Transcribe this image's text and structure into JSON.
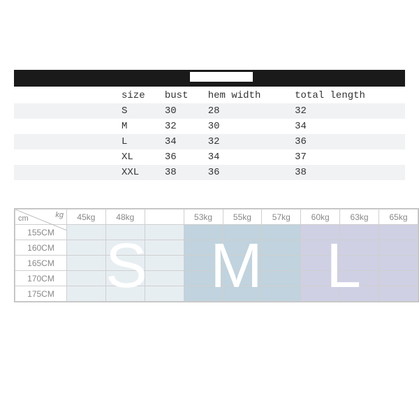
{
  "size_table": {
    "headers": [
      "size",
      "bust",
      "hem width",
      "total length"
    ],
    "rows": [
      {
        "size": "S",
        "bust": "30",
        "hem": "28",
        "total": "32"
      },
      {
        "size": "M",
        "bust": "32",
        "hem": "30",
        "total": "34"
      },
      {
        "size": "L",
        "bust": "34",
        "hem": "32",
        "total": "36"
      },
      {
        "size": "XL",
        "bust": "36",
        "hem": "34",
        "total": "37"
      },
      {
        "size": "XXL",
        "bust": "38",
        "hem": "36",
        "total": "38"
      }
    ]
  },
  "hw_table": {
    "corner_cm": "cm",
    "corner_kg": "kg",
    "weights": [
      "45kg",
      "48kg",
      "",
      "53kg",
      "55kg",
      "57kg",
      "60kg",
      "63kg",
      "65kg"
    ],
    "heights": [
      "155CM",
      "160CM",
      "165CM",
      "170CM",
      "175CM"
    ],
    "overlay": {
      "s": "S",
      "m": "M",
      "l": "L"
    }
  }
}
